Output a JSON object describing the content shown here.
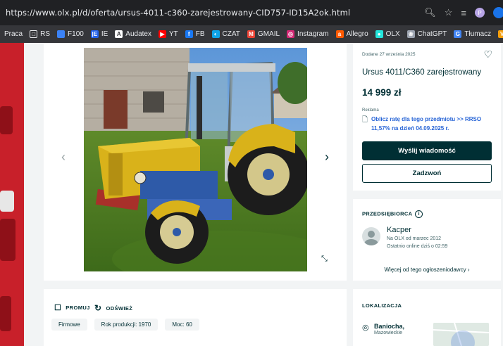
{
  "browser": {
    "url": "https://www.olx.pl/d/oferta/ursus-4011-c360-zarejestrowany-CID757-ID15A2ok.html",
    "profile_initial": "P"
  },
  "bookmarks": [
    {
      "label": "Praca",
      "icon": "none",
      "color": "#35363a"
    },
    {
      "label": "RS",
      "icon": "folder-icon",
      "color": "#35363a"
    },
    {
      "label": "F100",
      "icon": "f100-icon",
      "color": "#3b82f6"
    },
    {
      "label": "IE",
      "icon": "ie-icon",
      "color": "#2563eb"
    },
    {
      "label": "Audatex",
      "icon": "audatex-icon",
      "color": "#ffffff"
    },
    {
      "label": "YT",
      "icon": "youtube-icon",
      "color": "#ff0000"
    },
    {
      "label": "FB",
      "icon": "facebook-icon",
      "color": "#1877f2"
    },
    {
      "label": "CZAT",
      "icon": "chat-icon",
      "color": "#0ea5e9"
    },
    {
      "label": "GMAIL",
      "icon": "gmail-icon",
      "color": "#ea4335"
    },
    {
      "label": "Instagram",
      "icon": "instagram-icon",
      "color": "#d62976"
    },
    {
      "label": "Allegro",
      "icon": "allegro-icon",
      "color": "#ff5a00"
    },
    {
      "label": "OLX",
      "icon": "olx-icon",
      "color": "#23e5db"
    },
    {
      "label": "ChatGPT",
      "icon": "chatgpt-icon",
      "color": "#9ca3af"
    },
    {
      "label": "Tłumacz",
      "icon": "translate-icon",
      "color": "#4285f4"
    },
    {
      "label": "Kalkula",
      "icon": "calculator-icon",
      "color": "#f59e0b"
    }
  ],
  "gallery": {
    "prev_icon": "chevron-left-icon",
    "next_icon": "chevron-right-icon",
    "expand_icon": "fullscreen-icon"
  },
  "actions": {
    "promote": "PROMUJ",
    "refresh": "ODŚWIEŻ"
  },
  "tags": [
    "Firmowe",
    "Rok produkcji: 1970",
    "Moc: 60"
  ],
  "listing": {
    "date": "Dodane 27 września 2025",
    "title": "Ursus 4011/C360 zarejestrowany",
    "price": "14 999 zł",
    "ad_label": "Reklama",
    "installment_link": "Oblicz ratę dla tego przedmiotu >> RRSO 11,57% na dzień 04.09.2025 r.",
    "message_button": "Wyślij wiadomość",
    "call_button": "Zadzwoń"
  },
  "seller": {
    "section_title": "PRZEDSIĘBIORCA",
    "name": "Kacper",
    "since": "Na OLX od marzec 2012",
    "last_online": "Ostatnio online dziś o 02:59",
    "more_link": "Więcej od tego ogłoszeniodawcy"
  },
  "location": {
    "section_title": "LOKALIZACJA",
    "city": "Baniocha,",
    "region": "Mazowieckie"
  },
  "colors": {
    "brand_dark": "#002f34",
    "link_blue": "#2563d6",
    "side_red": "#c8202a"
  }
}
